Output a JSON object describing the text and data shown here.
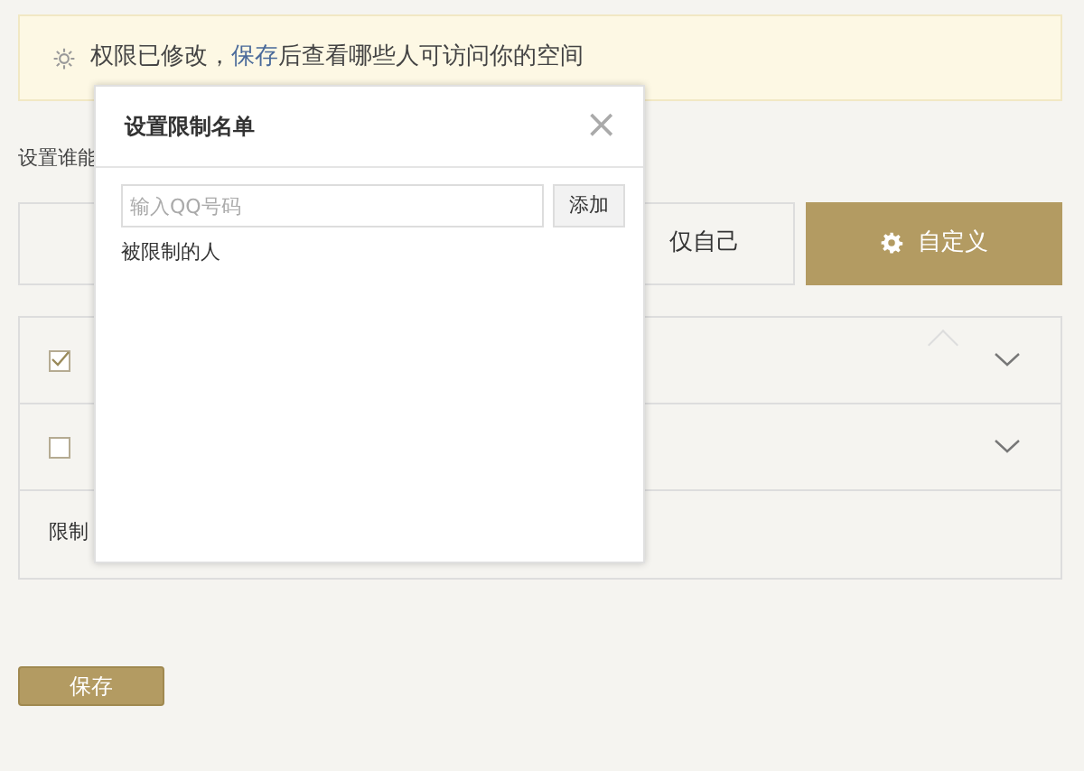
{
  "notice": {
    "before": "权限已修改，",
    "link": "保存",
    "after": "后查看哪些人可访问你的空间"
  },
  "section_label": "设置谁能",
  "options": [
    {
      "label": "仅自己",
      "selected": false,
      "kind": "plain"
    },
    {
      "label": "自定义",
      "selected": true,
      "kind": "custom"
    }
  ],
  "rows": [
    {
      "checked": true
    },
    {
      "checked": false
    }
  ],
  "restrict_label": "限制",
  "save_button": "保存",
  "dialog": {
    "title": "设置限制名单",
    "close": "×",
    "input": {
      "placeholder": "输入QQ号码"
    },
    "add_button": "添加",
    "list_label": "被限制的人"
  }
}
